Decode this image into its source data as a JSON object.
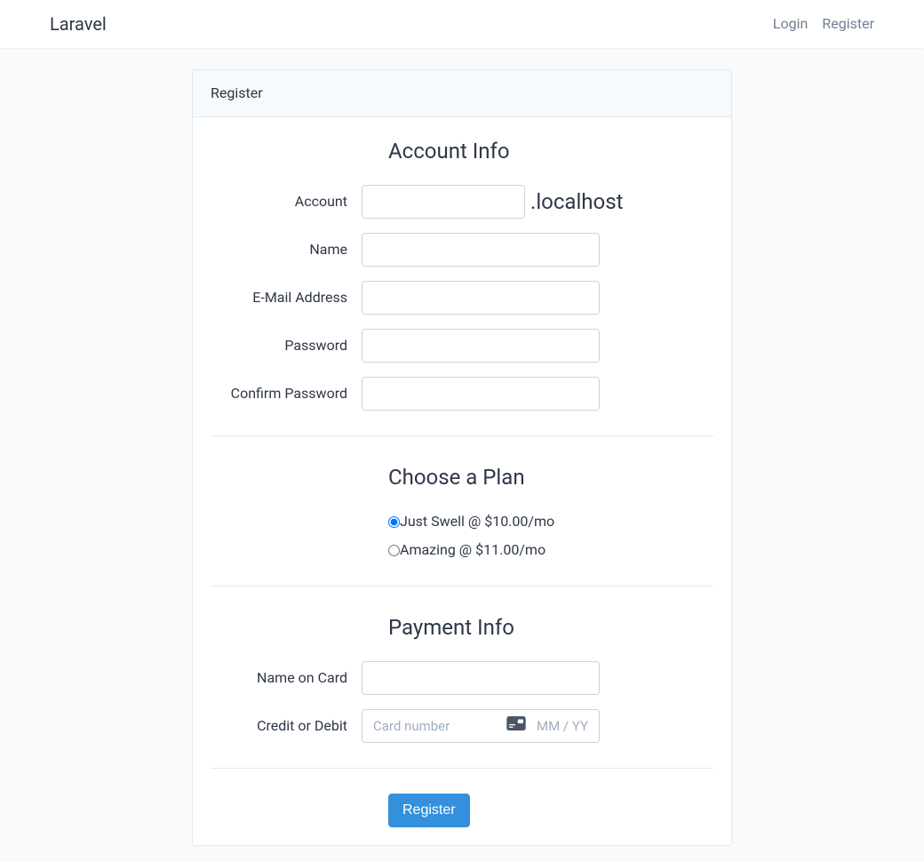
{
  "navbar": {
    "brand": "Laravel",
    "login_link": "Login",
    "register_link": "Register"
  },
  "card": {
    "header": "Register"
  },
  "account_section": {
    "heading": "Account Info",
    "account_label": "Account",
    "account_value": "",
    "account_suffix": ".localhost",
    "name_label": "Name",
    "name_value": "",
    "email_label": "E-Mail Address",
    "email_value": "",
    "password_label": "Password",
    "password_value": "",
    "confirm_password_label": "Confirm Password",
    "confirm_password_value": ""
  },
  "plan_section": {
    "heading": "Choose a Plan",
    "plans": [
      {
        "label": "Just Swell @ $10.00/mo",
        "selected": true
      },
      {
        "label": "Amazing @ $11.00/mo",
        "selected": false
      }
    ]
  },
  "payment_section": {
    "heading": "Payment Info",
    "name_on_card_label": "Name on Card",
    "name_on_card_value": "",
    "credit_debit_label": "Credit or Debit",
    "card_number_placeholder": "Card number",
    "expiry_placeholder": "MM / YY"
  },
  "submit": {
    "button_label": "Register"
  }
}
